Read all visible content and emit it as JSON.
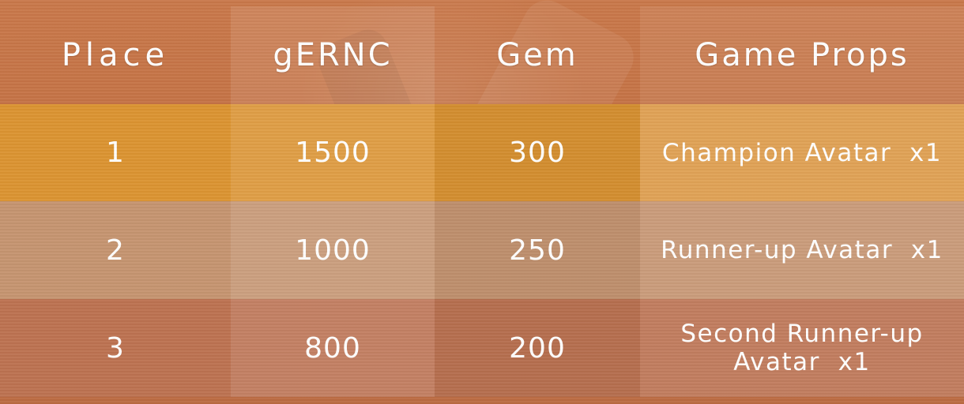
{
  "table": {
    "headers": {
      "place": "Place",
      "gernc": "gERNC",
      "gem": "Gem",
      "props": "Game Props"
    },
    "rows": [
      {
        "place": "1",
        "gernc": "1500",
        "gem": "300",
        "props": "Champion Avatar  x1"
      },
      {
        "place": "2",
        "gernc": "1000",
        "gem": "250",
        "props": "Runner-up Avatar  x1"
      },
      {
        "place": "3",
        "gernc": "800",
        "gem": "200",
        "props": "Second Runner-up Avatar  x1"
      }
    ]
  },
  "colors": {
    "background": "#c27043",
    "row_1": "#db9331",
    "row_2": "#c59470",
    "row_3": "#bc7251",
    "text": "#ffffff"
  }
}
